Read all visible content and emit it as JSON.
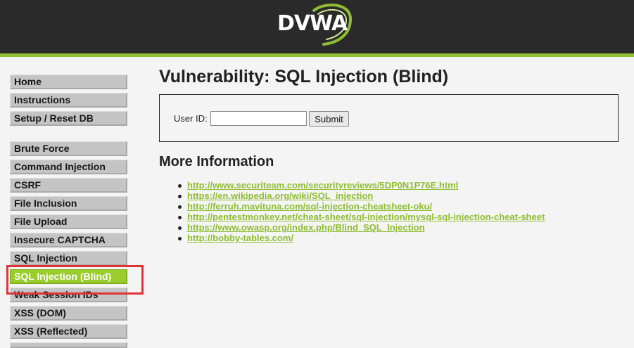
{
  "header": {
    "logo_text": "DVWA",
    "colors": {
      "bar": "#2a2a2a",
      "stripe": "#8fbe32"
    }
  },
  "menu": {
    "selected": "SQL Injection (Blind)",
    "items": [
      "Home",
      "Instructions",
      "Setup / Reset DB",
      "Brute Force",
      "Command Injection",
      "CSRF",
      "File Inclusion",
      "File Upload",
      "Insecure CAPTCHA",
      "SQL Injection",
      "SQL Injection (Blind)",
      "Weak Session IDs",
      "XSS (DOM)",
      "XSS (Reflected)"
    ]
  },
  "main": {
    "title": "Vulnerability: SQL Injection (Blind)",
    "form": {
      "user_id_label": "User ID:",
      "user_id_value": "",
      "submit_label": "Submit"
    },
    "more_info": {
      "heading": "More Information",
      "links": [
        "http://www.securiteam.com/securityreviews/5DP0N1P76E.html",
        "https://en.wikipedia.org/wiki/SQL_injection",
        "http://ferruh.mavituna.com/sql-injection-cheatsheet-oku/",
        "http://pentestmonkey.net/cheat-sheet/sql-injection/mysql-sql-injection-cheat-sheet",
        "https://www.owasp.org/index.php/Blind_SQL_Injection",
        "http://bobby-tables.com/"
      ]
    }
  },
  "annotation": {
    "color": "#e03434"
  },
  "colors": {
    "link": "#8fbe32",
    "selected_menu": "#9acc2b"
  }
}
